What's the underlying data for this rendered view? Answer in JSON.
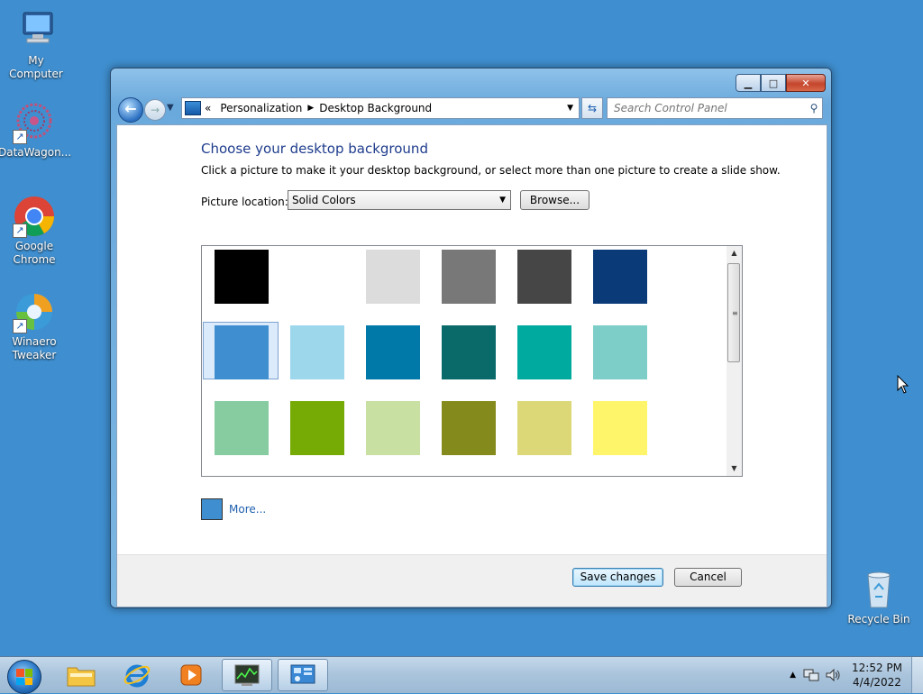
{
  "desktop": {
    "icons": [
      {
        "label": "My Computer"
      },
      {
        "label": "DataWagon..."
      },
      {
        "label": "Google Chrome"
      },
      {
        "label": "Winaero Tweaker"
      },
      {
        "label": "Recycle Bin"
      }
    ]
  },
  "window": {
    "breadcrumb": {
      "overflow": "«",
      "items": [
        "Personalization",
        "Desktop Background"
      ]
    },
    "search": {
      "placeholder": "Search Control Panel"
    },
    "heading": "Choose your desktop background",
    "subtext": "Click a picture to make it your desktop background, or select more than one picture to create a slide show.",
    "picture_location": {
      "label": "Picture location:",
      "value": "Solid Colors"
    },
    "browse_label": "Browse...",
    "swatches": [
      [
        "#000000",
        "#ffffff",
        "#dcdcdc",
        "#787878",
        "#464646",
        "#0a3a78"
      ],
      [
        "#3f8fd0",
        "#9dd7ec",
        "#0078a8",
        "#0a6a6a",
        "#00aa9e",
        "#7dcec8"
      ],
      [
        "#86cca0",
        "#76aa05",
        "#c8e0a2",
        "#858a1c",
        "#dcd878",
        "#fff56a"
      ]
    ],
    "selected_swatch": "#3f8fd0",
    "more_label": "More...",
    "save_label": "Save changes",
    "cancel_label": "Cancel"
  },
  "taskbar": {
    "time": "12:52 PM",
    "date": "4/4/2022"
  }
}
